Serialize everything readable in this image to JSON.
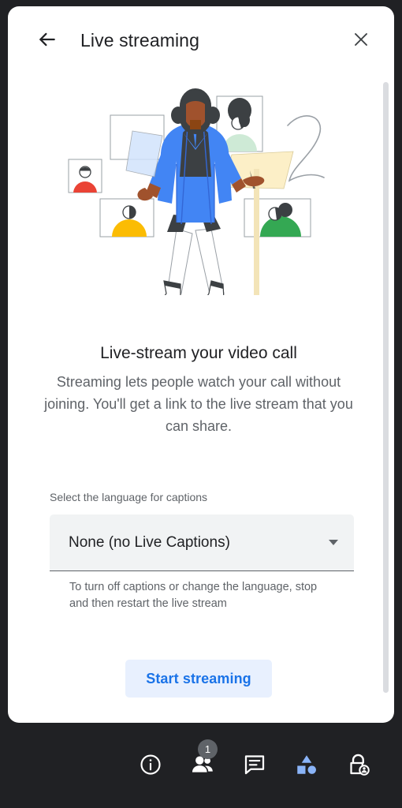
{
  "window": {
    "background_color": "#202124",
    "panel_background": "#ffffff"
  },
  "header": {
    "back_icon": "back-arrow-icon",
    "title": "Live streaming",
    "close_icon": "close-icon"
  },
  "illustration": {
    "name": "live-streaming-illustration",
    "description": "Woman in blue blazer presenting, surrounded by video call tiles",
    "colors": {
      "blazer": "#4285f4",
      "blazer_shadow": "#3367d6",
      "skin": "#a0522d",
      "skin_dark": "#8b4513",
      "hair": "#3c4043",
      "trousers": "#ffffff",
      "tile_border": "#9aa0a6",
      "tile_red": "#ea4335",
      "tile_yellow": "#fbbc04",
      "tile_green": "#34a853",
      "tile_mint": "#ceead6",
      "paper_blue": "#d2e3fc",
      "banner_cream": "#fcefc7",
      "pole": "#f3e4b8",
      "squiggle": "#9aa0a6"
    }
  },
  "main": {
    "headline": "Live-stream your video call",
    "subtext": "Streaming lets people watch your call without joining. You'll get a link to the live stream that you can share.",
    "field_label": "Select the language for captions",
    "select_value": "None (no Live Captions)",
    "select_caret_icon": "chevron-down-icon",
    "field_hint": "To turn off captions or change the language, stop and then restart the live stream",
    "start_button": "Start streaming",
    "start_button_color": "#1a73e8",
    "start_button_background": "#e8f0fe"
  },
  "scrollbar": {
    "thumb_color": "#dadce0"
  },
  "bottom_bar": {
    "items": [
      {
        "name": "meeting-details-button",
        "icon": "info-icon",
        "badge": null
      },
      {
        "name": "people-button",
        "icon": "people-icon",
        "badge": "1"
      },
      {
        "name": "chat-button",
        "icon": "chat-icon",
        "badge": null
      },
      {
        "name": "activities-button",
        "icon": "activities-icon",
        "badge": null
      },
      {
        "name": "host-controls-button",
        "icon": "lock-person-icon",
        "badge": null
      }
    ],
    "activities_icon_color": "#8ab4f8",
    "badge_background": "#5f6368"
  }
}
